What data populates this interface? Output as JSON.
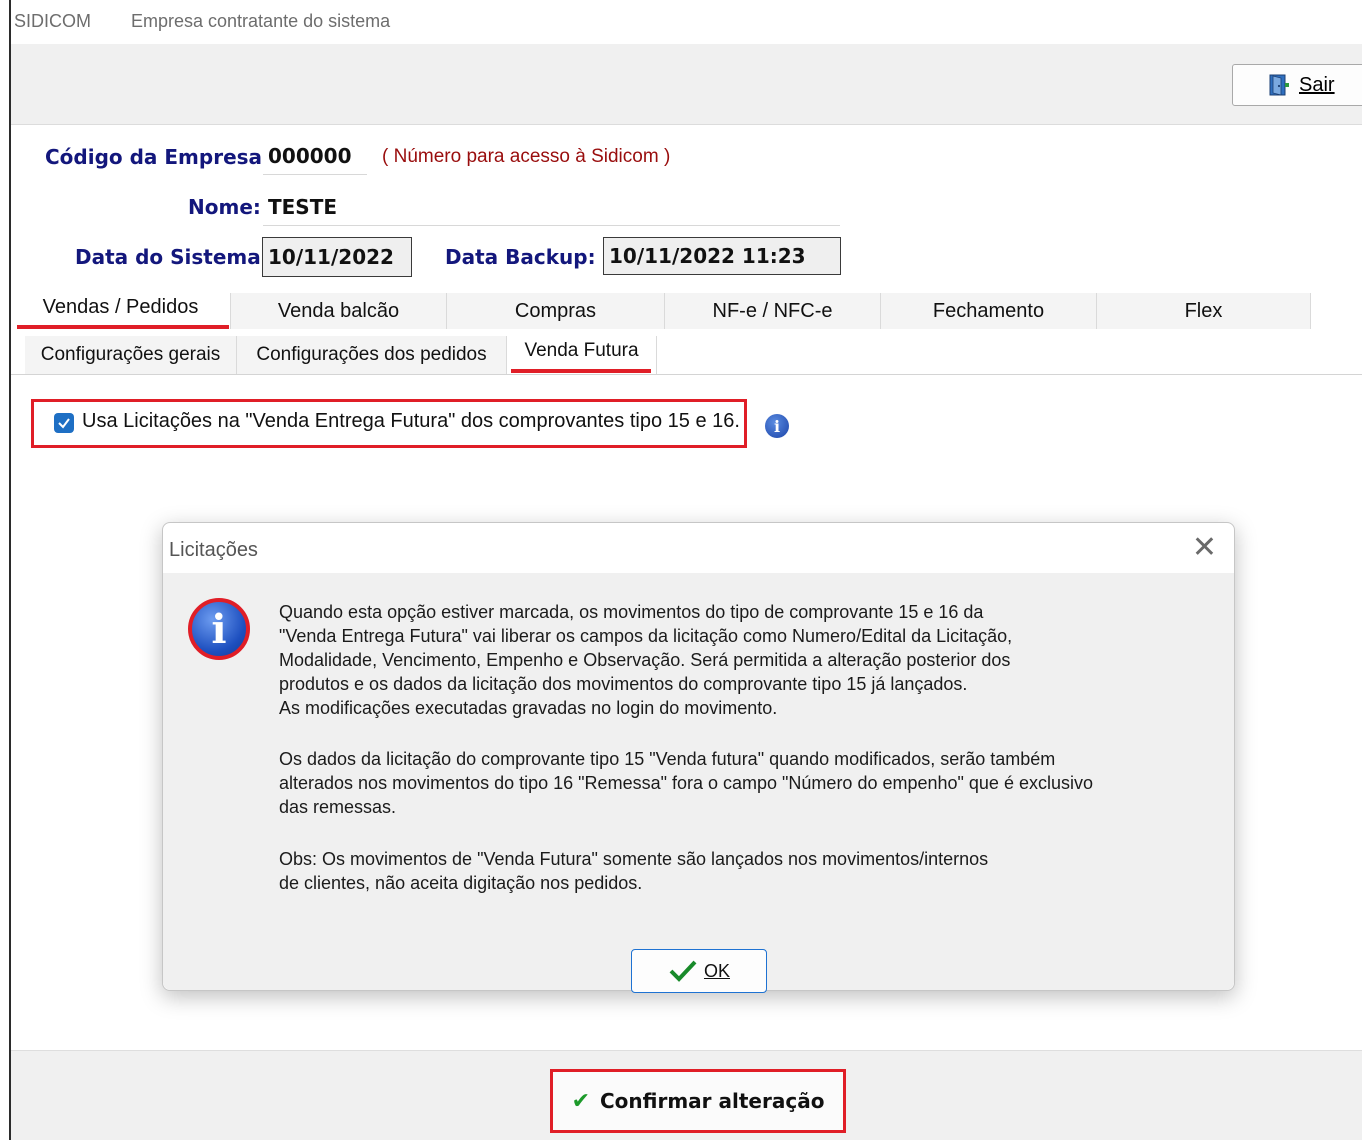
{
  "window": {
    "app_name": "SIDICOM",
    "subtitle": "Empresa contratante do sistema"
  },
  "toolbar": {
    "exit_label": "Sair",
    "exit_icon": "door-exit-icon"
  },
  "form": {
    "codigo_label": "Código da Empresa:",
    "codigo_value": "000000",
    "codigo_note": "( Número para acesso à Sidicom )",
    "nome_label": "Nome:",
    "nome_value": "TESTE",
    "data_sistema_label": "Data do Sistema:",
    "data_sistema_value": "10/11/2022",
    "data_backup_label": "Data Backup:",
    "data_backup_value": "10/11/2022 11:23"
  },
  "main_tabs": [
    {
      "label": "Vendas / Pedidos",
      "active": true
    },
    {
      "label": "Venda balcão",
      "active": false
    },
    {
      "label": "Compras",
      "active": false
    },
    {
      "label": "NF-e / NFC-e",
      "active": false
    },
    {
      "label": "Fechamento",
      "active": false
    },
    {
      "label": "Flex",
      "active": false
    }
  ],
  "sub_tabs": [
    {
      "label": "Configurações gerais",
      "active": false
    },
    {
      "label": "Configurações dos pedidos",
      "active": false
    },
    {
      "label": "Venda Futura",
      "active": true
    }
  ],
  "option": {
    "checked": true,
    "label": "Usa Licitações na \"Venda Entrega Futura\" dos comprovantes tipo 15 e 16.",
    "info_icon": "info-icon"
  },
  "dialog": {
    "title": "Licitações",
    "close_glyph": "✕",
    "icon": "info-icon",
    "paragraph1": [
      "Quando esta opção estiver marcada, os movimentos do tipo de comprovante 15 e 16 da",
      "\"Venda Entrega Futura\" vai liberar os campos da licitação como Numero/Edital da Licitação,",
      "Modalidade, Vencimento, Empenho e Observação. Será permitida a alteração posterior dos",
      "produtos e os dados da licitação dos movimentos do comprovante tipo 15 já lançados.",
      "As modificações executadas gravadas no login do movimento."
    ],
    "paragraph2": [
      "Os dados da licitação do comprovante tipo 15 \"Venda futura\" quando modificados, serão também",
      "alterados nos movimentos do tipo 16 \"Remessa\" fora o campo \"Número do empenho\" que é exclusivo",
      "das remessas."
    ],
    "paragraph3": [
      "Obs: Os movimentos de \"Venda Futura\" somente são lançados nos movimentos/internos",
      "de clientes, não aceita digitação nos pedidos."
    ],
    "ok_label": "OK"
  },
  "footer": {
    "confirm_label": "Confirmar alteração"
  },
  "colors": {
    "label_blue": "#13177c",
    "highlight_red": "#e01e27",
    "note_red": "#990d0d",
    "check_green": "#1c9a2a",
    "checkbox_blue": "#1e6fc4"
  }
}
